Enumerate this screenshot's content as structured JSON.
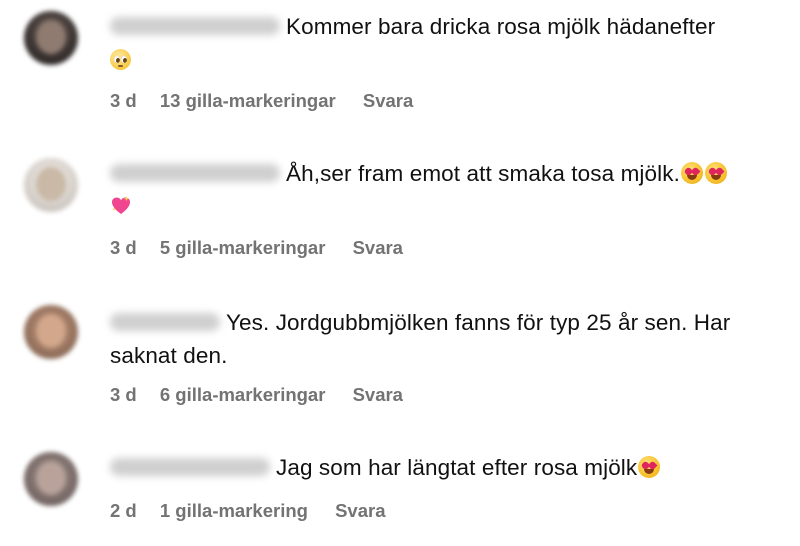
{
  "comments": [
    {
      "text_line1": "Kommer bara dricka rosa mjölk hädanefter",
      "emoji_trailing": "pleading-face",
      "time": "3 d",
      "likes": "13 gilla-markeringar",
      "reply": "Svara"
    },
    {
      "text_line1": "Åh,ser fram emot att smaka tosa mjölk.",
      "emoji_inline": [
        "heart-eyes-face",
        "heart-eyes-face"
      ],
      "emoji_trailing": "sparkling-heart",
      "time": "3 d",
      "likes": "5 gilla-markeringar",
      "reply": "Svara"
    },
    {
      "text_line1": "Yes. Jordgubbmjölken fanns för typ 25 år sen. Har",
      "text_line2": "saknat den.",
      "time": "3 d",
      "likes": "6 gilla-markeringar",
      "reply": "Svara"
    },
    {
      "text_line1": "Jag som har längtat efter rosa mjölk",
      "emoji_inline": [
        "heart-eyes-face"
      ],
      "time": "2 d",
      "likes": "1 gilla-markering",
      "reply": "Svara"
    }
  ],
  "colors": {
    "text": "#111111",
    "meta": "#737373",
    "background": "#ffffff"
  }
}
